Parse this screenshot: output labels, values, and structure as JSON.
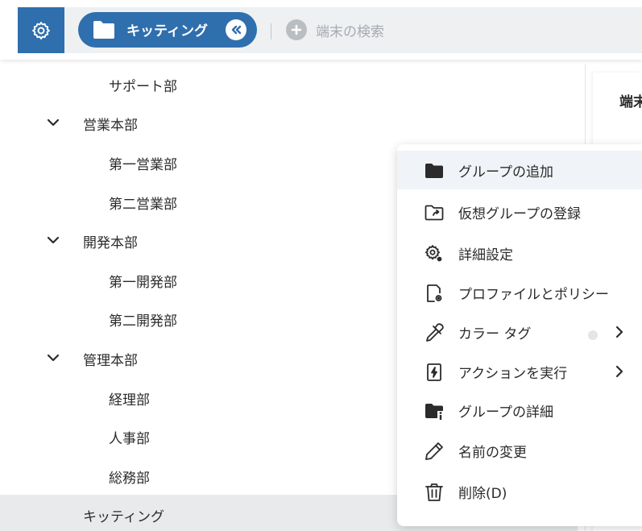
{
  "header": {
    "current_group_chip": "キッティング",
    "search_placeholder": "端末の検索",
    "icons": [
      "gear-icon",
      "folder-icon",
      "collapse-chevron-icon",
      "plus-icon"
    ]
  },
  "tree": {
    "items": [
      {
        "label": "サポート部",
        "level": 2,
        "expandable": false
      },
      {
        "label": "営業本部",
        "level": 1,
        "expandable": true
      },
      {
        "label": "第一営業部",
        "level": 2,
        "expandable": false
      },
      {
        "label": "第二営業部",
        "level": 2,
        "expandable": false
      },
      {
        "label": "開発本部",
        "level": 1,
        "expandable": true
      },
      {
        "label": "第一開発部",
        "level": 2,
        "expandable": false
      },
      {
        "label": "第二開発部",
        "level": 2,
        "expandable": false
      },
      {
        "label": "管理本部",
        "level": 1,
        "expandable": true
      },
      {
        "label": "経理部",
        "level": 2,
        "expandable": false
      },
      {
        "label": "人事部",
        "level": 2,
        "expandable": false
      },
      {
        "label": "総務部",
        "level": 2,
        "expandable": false
      },
      {
        "label": "キッティング",
        "level": 1,
        "expandable": false,
        "selected": true
      }
    ]
  },
  "right_panel": {
    "title_fragment": "端末"
  },
  "context_menu": {
    "items": [
      {
        "label": "グループの追加",
        "icon": "folder-icon",
        "hover": true
      },
      {
        "label": "仮想グループの登録",
        "icon": "virtual-folder-icon"
      },
      {
        "label": "詳細設定",
        "icon": "settings-icon"
      },
      {
        "label": "プロファイルとポリシー",
        "icon": "profile-policy-icon"
      },
      {
        "label": "カラー タグ",
        "icon": "eyedropper-icon",
        "submenu": true,
        "color_dot": "#e3e5e7"
      },
      {
        "label": "アクションを実行",
        "icon": "action-icon",
        "submenu": true
      },
      {
        "label": "グループの詳細",
        "icon": "folder-info-icon"
      },
      {
        "label": "名前の変更",
        "icon": "pencil-icon"
      },
      {
        "label": "削除(D)",
        "icon": "trash-icon"
      }
    ]
  },
  "colors": {
    "accent": "#2f6fad",
    "selected_row": "#e8eaec",
    "menu_hover": "#f0f4f8"
  }
}
